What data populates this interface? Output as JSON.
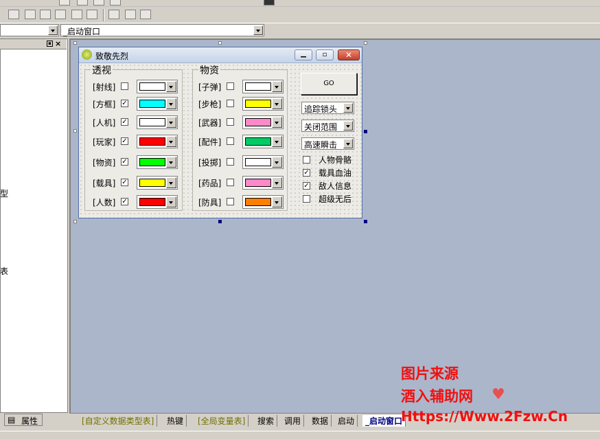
{
  "toolbar": {
    "left_combo_value": "",
    "right_combo_value": "_启动窗口"
  },
  "left_panel": {
    "side_text_1": "型",
    "side_text_2": "表",
    "properties_tab": "属性"
  },
  "form": {
    "title": "致敬先烈",
    "group_see": {
      "title": "透视",
      "rows": [
        {
          "label": "[射线]",
          "checked": false,
          "color": "#ffffff"
        },
        {
          "label": "[方框]",
          "checked": true,
          "color": "#00ffff"
        },
        {
          "label": "[人机]",
          "checked": true,
          "color": "#ffffff"
        },
        {
          "label": "[玩家]",
          "checked": true,
          "color": "#ff0000"
        },
        {
          "label": "[物资]",
          "checked": true,
          "color": "#00ff00"
        },
        {
          "label": "[载具]",
          "checked": true,
          "color": "#ffff00"
        },
        {
          "label": "[人数]",
          "checked": true,
          "color": "#ff0000"
        }
      ]
    },
    "group_items": {
      "title": "物资",
      "rows": [
        {
          "label": "[子弹]",
          "checked": false,
          "color": "#ffffff"
        },
        {
          "label": "[步枪]",
          "checked": false,
          "color": "#ffff00"
        },
        {
          "label": "[武器]",
          "checked": false,
          "color": "#ff88c8"
        },
        {
          "label": "[配件]",
          "checked": false,
          "color": "#00cc66"
        },
        {
          "label": "[投掷]",
          "checked": false,
          "color": "#ffffff"
        },
        {
          "label": "[药品]",
          "checked": false,
          "color": "#ff88c8"
        },
        {
          "label": "[防具]",
          "checked": false,
          "color": "#ff8000"
        }
      ]
    },
    "go_button": "GO",
    "selects": [
      "追踪锁头",
      "关闭范围",
      "高速瞬击"
    ],
    "options": [
      {
        "label": "人物骨骼",
        "checked": false
      },
      {
        "label": "载具血油",
        "checked": true
      },
      {
        "label": "敌人信息",
        "checked": true
      },
      {
        "label": "超级无后",
        "checked": false
      }
    ]
  },
  "tabs": [
    "[自定义数据类型表]",
    "热键",
    "[全局变量表]",
    "搜索",
    "调用",
    "数据",
    "启动",
    "_启动窗口"
  ],
  "watermark": {
    "line1": "图片来源",
    "line2": "酒入辅助网",
    "line3": "Https://Www.2Fzw.Cn"
  },
  "colors": {
    "designer_bg": "#abb6ca",
    "form_border": "#4f6fa8",
    "close_button": "#d9503a",
    "watermark": "#f01010"
  }
}
